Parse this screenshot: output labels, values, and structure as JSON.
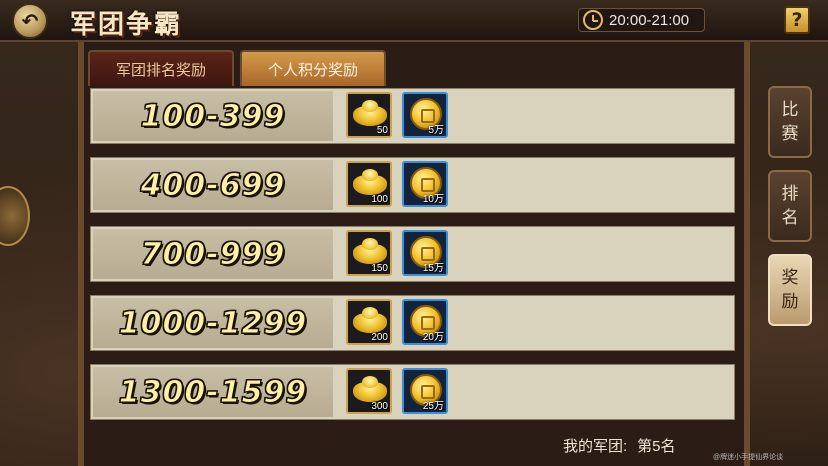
{
  "header": {
    "title": "军团争霸",
    "time_range": "20:00-21:00",
    "help_label": "?"
  },
  "tabs": [
    {
      "label": "军团排名奖励",
      "active": false
    },
    {
      "label": "个人积分奖励",
      "active": true
    }
  ],
  "reward_rows": [
    {
      "range": "100-399",
      "rewards": [
        {
          "icon": "gold-ingot-icon",
          "amount": "50"
        },
        {
          "icon": "gold-coin-icon",
          "amount": "5万"
        }
      ]
    },
    {
      "range": "400-699",
      "rewards": [
        {
          "icon": "gold-ingot-icon",
          "amount": "100"
        },
        {
          "icon": "gold-coin-icon",
          "amount": "10万"
        }
      ]
    },
    {
      "range": "700-999",
      "rewards": [
        {
          "icon": "gold-ingot-icon",
          "amount": "150"
        },
        {
          "icon": "gold-coin-icon",
          "amount": "15万"
        }
      ]
    },
    {
      "range": "1000-1299",
      "rewards": [
        {
          "icon": "gold-ingot-icon",
          "amount": "200"
        },
        {
          "icon": "gold-coin-icon",
          "amount": "20万"
        }
      ]
    },
    {
      "range": "1300-1599",
      "rewards": [
        {
          "icon": "gold-ingot-icon",
          "amount": "300"
        },
        {
          "icon": "gold-coin-icon",
          "amount": "25万"
        }
      ]
    }
  ],
  "side_nav": [
    {
      "label_top": "比",
      "label_bottom": "赛",
      "active": false
    },
    {
      "label_top": "排",
      "label_bottom": "名",
      "active": false
    },
    {
      "label_top": "奖",
      "label_bottom": "励",
      "active": true
    }
  ],
  "footer": {
    "my_legion_label": "我的军团:",
    "my_legion_rank": "第5名"
  },
  "watermark": "@牌迷小手提仙界论谈",
  "colors": {
    "accent_gold": "#f0c22e",
    "active_tab": "#d39a4a",
    "row_bg": "#d9d2bd"
  }
}
